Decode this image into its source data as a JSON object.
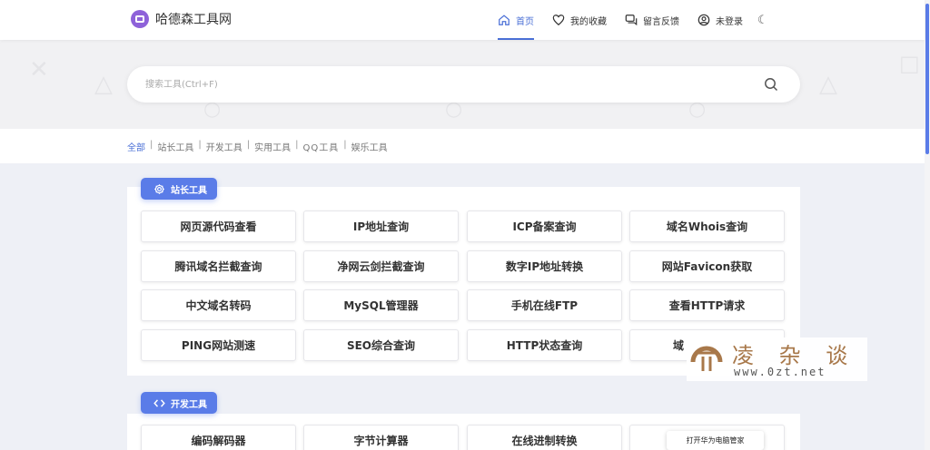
{
  "header": {
    "site_name": "哈德森工具网",
    "nav": [
      {
        "label": "首页",
        "icon": "home-icon",
        "active": true
      },
      {
        "label": "我的收藏",
        "icon": "heart-icon"
      },
      {
        "label": "留言反馈",
        "icon": "message-icon"
      },
      {
        "label": "未登录",
        "icon": "user-icon"
      }
    ],
    "theme_icon": "moon-icon"
  },
  "search": {
    "placeholder": "搜索工具(Ctrl+F)",
    "icon": "search-icon"
  },
  "categories": [
    "全部",
    "站长工具",
    "开发工具",
    "实用工具",
    "QQ工具",
    "娱乐工具"
  ],
  "categories_separator": "|",
  "sections": [
    {
      "title": "站长工具",
      "icon": "gear-icon",
      "tools": [
        "网页源代码查看",
        "IP地址查询",
        "ICP备案查询",
        "域名Whois查询",
        "腾讯域名拦截查询",
        "净网云剑拦截查询",
        "数字IP地址转换",
        "网站Favicon获取",
        "中文域名转码",
        "MySQL管理器",
        "手机在线FTP",
        "查看HTTP请求",
        "PING网站测速",
        "SEO综合查询",
        "HTTP状态查询",
        "域"
      ]
    },
    {
      "title": "开发工具",
      "icon": "code-icon",
      "tools": [
        "编码解码器",
        "字节计算器",
        "在线进制转换",
        ""
      ]
    }
  ],
  "watermark": {
    "title": "凌 杂 谈",
    "url": "www.0zt.net"
  },
  "tooltip": "打开华为电脑管家",
  "colors": {
    "accent": "#4a6fd6",
    "badge": "#5a7ce8",
    "logo": "#8e62d9",
    "watermark": "#a8784a"
  }
}
